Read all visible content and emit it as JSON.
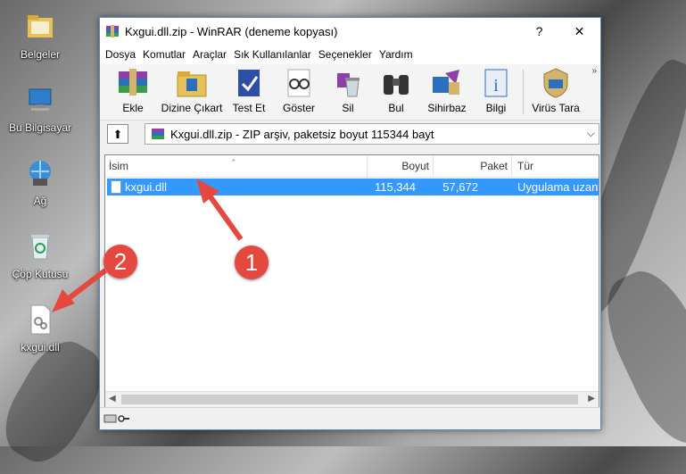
{
  "desktop": {
    "icons": [
      {
        "label": "Belgeler",
        "icon": "folder-icon"
      },
      {
        "label": "Bu Bilgisayar",
        "icon": "computer-icon"
      },
      {
        "label": "Ağ",
        "icon": "network-icon"
      },
      {
        "label": "Çöp Kutusu",
        "icon": "recycle-bin-icon"
      },
      {
        "label": "kxgui.dll",
        "icon": "dll-file-icon"
      }
    ]
  },
  "window": {
    "title": "Kxgui.dll.zip - WinRAR (deneme kopyası)",
    "help": "?",
    "close": "✕"
  },
  "menu": [
    "Dosya",
    "Komutlar",
    "Araçlar",
    "Sık Kullanılanlar",
    "Seçenekler",
    "Yardım"
  ],
  "toolbar": {
    "buttons": [
      "Ekle",
      "Dizine Çıkart",
      "Test Et",
      "Göster",
      "Sil",
      "Bul",
      "Sihirbaz",
      "Bilgi",
      "Virüs Tara"
    ],
    "more": "»"
  },
  "address": {
    "text": "Kxgui.dll.zip - ZIP arşiv, paketsiz boyut 115344 bayt",
    "chevron": "⌵"
  },
  "columns": [
    "İsim",
    "Boyut",
    "Paket",
    "Tür"
  ],
  "files": [
    {
      "name": "kxgui.dll",
      "size": "115,344",
      "packed": "57,672",
      "type": "Uygulama uzantısı"
    }
  ],
  "badges": [
    "1",
    "2"
  ],
  "colors": {
    "selection": "#3399ff",
    "badge": "#e5483f",
    "arrow": "#e5483f"
  }
}
